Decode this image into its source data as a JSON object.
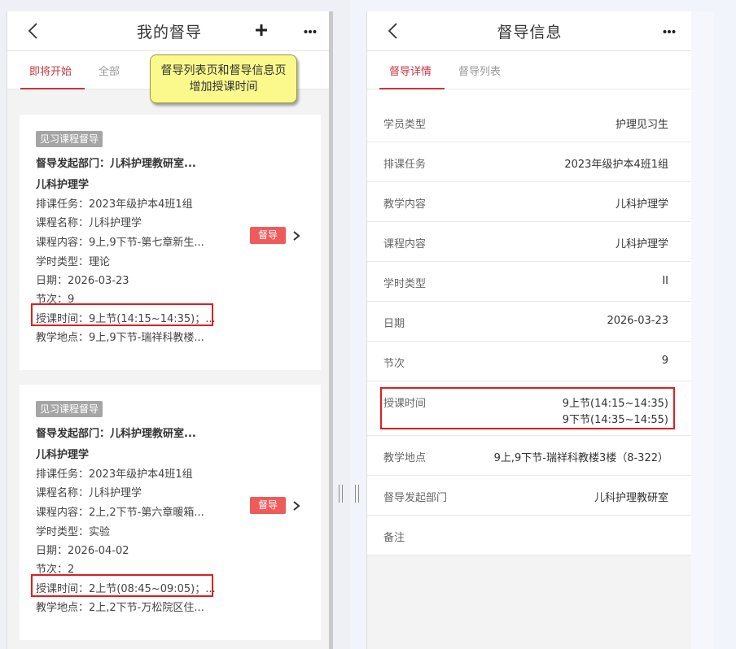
{
  "left": {
    "title": "我的督导",
    "tabs": [
      {
        "label": "即将开始",
        "active": true
      },
      {
        "label": "全部",
        "active": false
      }
    ],
    "cards": [
      {
        "type_badge": "见习课程督导",
        "dept": "督导发起部门：儿科护理教研室...",
        "course_title": "儿科护理学",
        "schedule": "排课任务：2023年级护本4班1组",
        "course_name": "课程名称：儿科护理学",
        "content": "课程内容：9上,9下节-第七章新生...",
        "hour_type": "学时类型：理论",
        "date": "日期：2026-03-23",
        "section": "节次：9",
        "time": "授课时间：9上节(14:15~14:35)；...",
        "place": "教学地点：9上,9下节-瑞祥科教楼...",
        "action": "督导"
      },
      {
        "type_badge": "见习课程督导",
        "dept": "督导发起部门：儿科护理教研室...",
        "course_title": "儿科护理学",
        "schedule": "排课任务：2023年级护本4班1组",
        "course_name": "课程名称：儿科护理学",
        "content": "课程内容：2上,2下节-第六章暖箱...",
        "hour_type": "学时类型：实验",
        "date": "日期：2026-04-02",
        "section": "节次：2",
        "time": "授课时间：2上节(08:45~09:05)；...",
        "place": "教学地点：2上,2下节-万松院区住...",
        "action": "督导"
      }
    ]
  },
  "callout": {
    "text": "督导列表页和督导信息页增加授课时间"
  },
  "right": {
    "title": "督导信息",
    "tabs": [
      {
        "label": "督导详情",
        "active": true
      },
      {
        "label": "督导列表",
        "active": false
      }
    ],
    "rows": [
      {
        "label": "学员类型",
        "value": "护理见习生"
      },
      {
        "label": "排课任务",
        "value": "2023年级护本4班1组"
      },
      {
        "label": "教学内容",
        "value": "儿科护理学"
      },
      {
        "label": "课程内容",
        "value": "儿科护理学"
      },
      {
        "label": "学时类型",
        "value": "II"
      },
      {
        "label": "日期",
        "value": "2026-03-23"
      },
      {
        "label": "节次",
        "value": "9"
      }
    ],
    "time_row": {
      "label": "授课时间",
      "value_1": "9上节(14:15~14:35)",
      "value_2": "9下节(14:35~14:55)"
    },
    "rows_after": [
      {
        "label": "教学地点",
        "value": "9上,9下节-瑞祥科教楼3楼（8-322）"
      },
      {
        "label": "督导发起部门",
        "value": "儿科护理教研室"
      },
      {
        "label": "备注",
        "value": ""
      }
    ]
  },
  "colors": {
    "accent": "#c8363d",
    "action_button": "#ef5b5b",
    "highlight": "#e21d1d",
    "callout_bg": "#fbf98c"
  },
  "icons": [
    "back-icon",
    "plus-icon",
    "more-icon",
    "chevron-right-icon",
    "drag-grip-icon"
  ]
}
